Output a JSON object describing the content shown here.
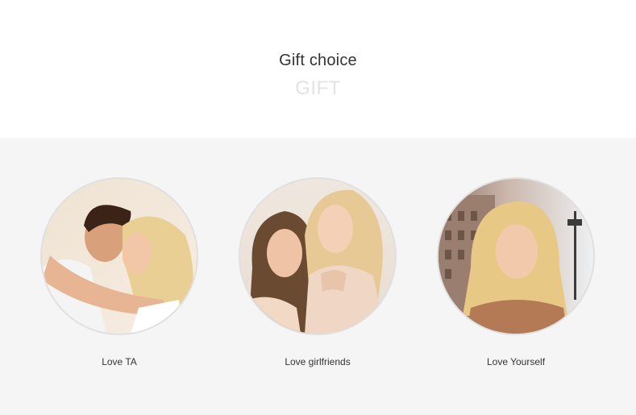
{
  "header": {
    "title": "Gift choice",
    "subtitle": "GIFT"
  },
  "cards": [
    {
      "label": "Love TA",
      "image": "couple-embracing-photo"
    },
    {
      "label": "Love girlfriends",
      "image": "two-women-friends-photo"
    },
    {
      "label": "Love Yourself",
      "image": "blonde-woman-city-photo"
    }
  ],
  "colors": {
    "title": "#333333",
    "subtitle": "#e3e3e3",
    "section_bg": "#f5f5f5",
    "circle_border": "#e0e0e0"
  }
}
